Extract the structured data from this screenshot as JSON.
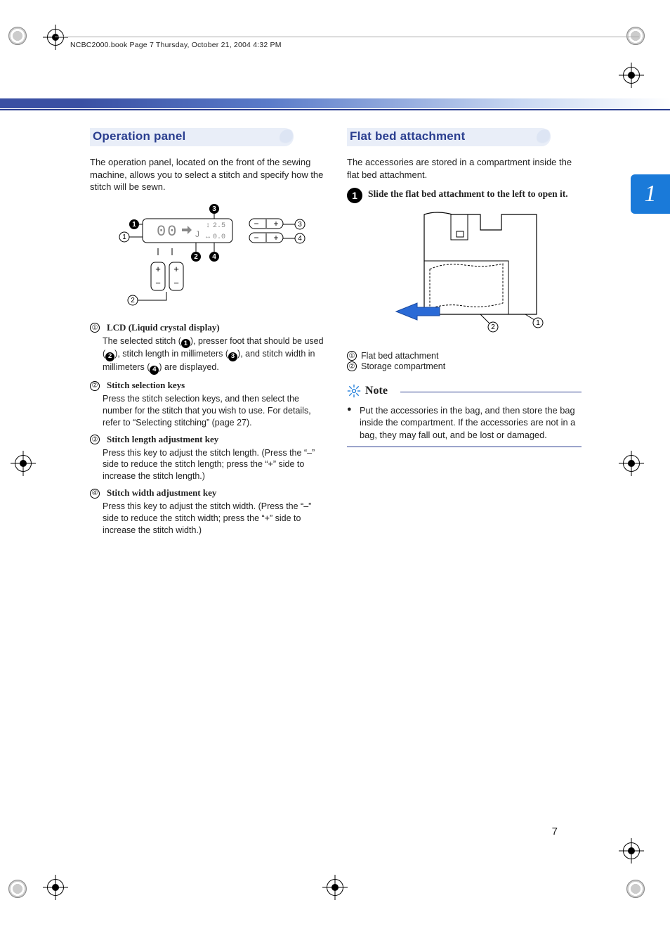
{
  "header_stamp": "NCBC2000.book  Page 7  Thursday, October 21, 2004  4:32 PM",
  "chapter_tab": "1",
  "page_number": "7",
  "left": {
    "heading": "Operation panel",
    "intro": "The operation panel, located on the front of the sewing machine, allows you to select a stitch and specify how the stitch will be sewn.",
    "legend": [
      {
        "marker": "①",
        "title": "LCD (Liquid crystal display)",
        "desc_before": "The selected stitch (",
        "desc_mid1": "), presser foot that should be used (",
        "desc_mid2": "), stitch length in millimeters (",
        "desc_mid3": "), and stitch width in millimeters (",
        "desc_after": ") are displayed.",
        "inline_icons": [
          "1",
          "2",
          "3",
          "4"
        ]
      },
      {
        "marker": "②",
        "title": "Stitch selection keys",
        "desc": "Press the stitch selection keys, and then select the number for the stitch that you wish to use. For details, refer to “Selecting stitching” (page 27)."
      },
      {
        "marker": "③",
        "title": "Stitch length adjustment key",
        "desc": "Press this key to adjust the stitch length. (Press the “–” side to reduce the stitch length; press the “+” side to increase the stitch length.)"
      },
      {
        "marker": "④",
        "title": "Stitch width adjustment key",
        "desc": "Press this key to adjust the stitch width. (Press the “–” side to reduce the stitch width; press the “+” side to increase the stitch width.)"
      }
    ],
    "diagram": {
      "lcd_stitch": "00",
      "lcd_foot_icon": "J",
      "lcd_length": "2.5",
      "lcd_width": "0.0",
      "callout_solid": [
        "1",
        "2",
        "3",
        "4"
      ],
      "callout_hollow": [
        "1",
        "2",
        "3",
        "4"
      ]
    }
  },
  "right": {
    "heading": "Flat bed attachment",
    "intro": "The accessories are stored in a compartment inside the flat bed attachment.",
    "step": {
      "num": "1",
      "text": "Slide the flat bed attachment to the left to open it."
    },
    "callouts": [
      {
        "marker": "①",
        "text": "Flat bed attachment"
      },
      {
        "marker": "②",
        "text": "Storage compartment"
      }
    ],
    "note": {
      "label": "Note",
      "text": "Put the accessories in the bag, and then store the bag inside the compartment. If the accessories are not in a bag, they may fall out, and be lost or damaged."
    }
  }
}
